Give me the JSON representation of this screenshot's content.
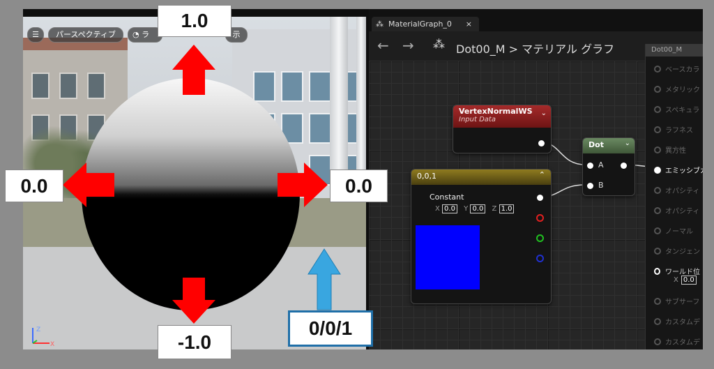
{
  "viewport": {
    "menu_icon": "hamburger-icon",
    "perspective_label": "パースペクティブ",
    "lit_label": "ラ",
    "show_label": "示",
    "axis_labels": {
      "z": "Z",
      "x": "X"
    }
  },
  "annotations": {
    "top": "1.0",
    "bottom": "-1.0",
    "left": "0.0",
    "right": "0.0",
    "vector": "0/0/1",
    "arrow_color": "#ff0000",
    "vector_arrow_color": "#39a6e0"
  },
  "editor": {
    "tab_title": "MaterialGraph_0",
    "tab_close": "×",
    "breadcrumb_asset": "Dot00_M",
    "breadcrumb_sep": ">",
    "breadcrumb_page": "マテリアル グラフ",
    "nodes": {
      "vertex_normal": {
        "title": "VertexNormalWS",
        "subtitle": "Input Data",
        "color": "#8a1c1c"
      },
      "dot": {
        "title": "Dot",
        "pin_a": "A",
        "pin_b": "B",
        "color": "#4d6b45"
      },
      "constant": {
        "title": "0,0,1",
        "label": "Constant",
        "x_label": "X",
        "x_value": "0.0",
        "y_label": "Y",
        "y_value": "0.0",
        "z_label": "Z",
        "z_value": "1.0",
        "swatch_color": "#0000ff",
        "header_color": "#7a6a1a"
      }
    },
    "result_node": {
      "title": "Dot00_M",
      "pins": [
        "ベースカラ",
        "メタリック",
        "スペキュラ",
        "ラフネス",
        "異方性",
        "エミッシブカ",
        "オパシティ",
        "オパシティ",
        "ノーマル",
        "タンジェン",
        "ワールド位",
        "サブサーフ",
        "カスタムデ",
        "カスタムデ"
      ],
      "wpo_x_label": "X",
      "wpo_x_value": "0.0"
    }
  }
}
